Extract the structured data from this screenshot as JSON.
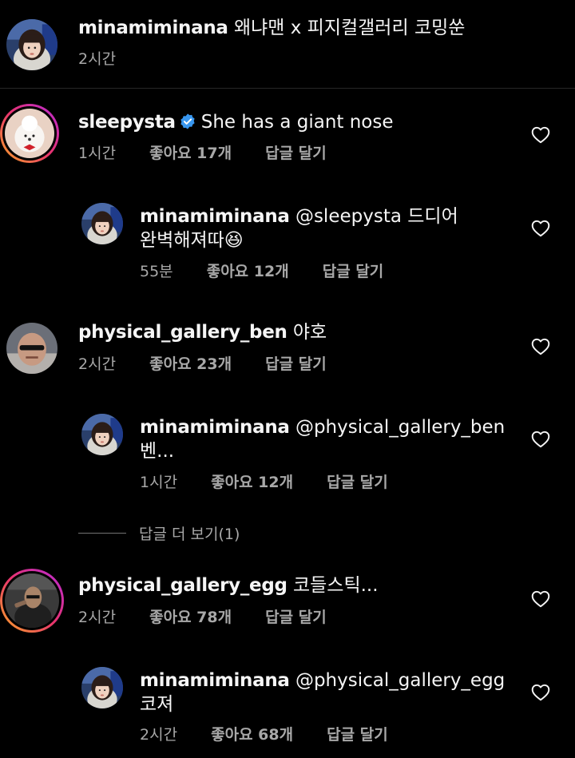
{
  "caption": {
    "username": "minamiminana",
    "text": "왜냐맨 x 피지컬갤러리 코밍쑨",
    "time": "2시간"
  },
  "comments": [
    {
      "username": "sleepysta",
      "verified": true,
      "text": "She has a giant nose",
      "time": "1시간",
      "likes": "좋아요 17개",
      "reply": "답글 달기"
    },
    {
      "username": "minamiminana",
      "text_line1": "@sleepysta 드디어",
      "text_line2": "완벽해져따😆",
      "time": "55분",
      "likes": "좋아요 12개",
      "reply": "답글 달기"
    },
    {
      "username": "physical_gallery_ben",
      "text": "야호",
      "time": "2시간",
      "likes": "좋아요 23개",
      "reply": "답글 달기"
    },
    {
      "username": "minamiminana",
      "text_line1": "@physical_gallery_ben",
      "text_line2": "벤...",
      "time": "1시간",
      "likes": "좋아요 12개",
      "reply": "답글 달기"
    },
    {
      "username": "physical_gallery_egg",
      "text": "코들스틱...",
      "time": "2시간",
      "likes": "좋아요 78개",
      "reply": "답글 달기"
    },
    {
      "username": "minamiminana",
      "text_line1": "@physical_gallery_egg",
      "text_line2": "코져",
      "time": "2시간",
      "likes": "좋아요 68개",
      "reply": "답글 달기"
    }
  ],
  "more_replies": "답글 더 보기(1)",
  "icons": {
    "like": "heart-outline-icon",
    "verified": "verified-badge-icon"
  },
  "colors": {
    "background": "#000000",
    "text_primary": "#f5f5f5",
    "text_secondary": "#a8a8a8",
    "verified": "#3897f0"
  }
}
